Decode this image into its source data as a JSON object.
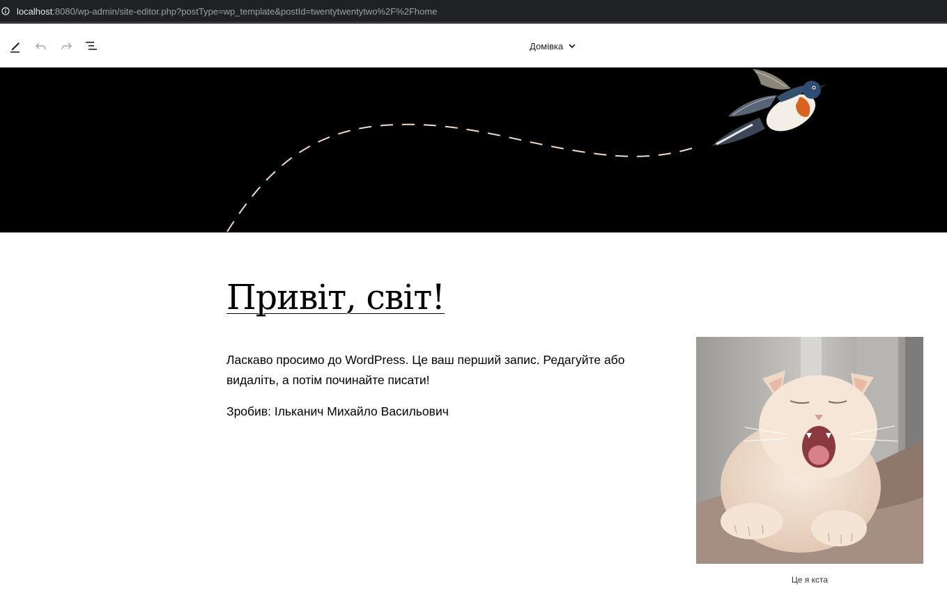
{
  "browser": {
    "url_host": "localhost",
    "url_rest": ":8080/wp-admin/site-editor.php?postType=wp_template&postId=twentytwentytwo%2F%2Fhome"
  },
  "toolbar": {
    "edit_icon": "pencil-icon",
    "undo_icon": "undo-icon",
    "redo_icon": "redo-icon",
    "list_view_icon": "list-view-icon",
    "template_name": "Домівка",
    "template_dropdown_icon": "chevron-down-icon"
  },
  "post": {
    "title": "Привіт, світ!",
    "paragraphs": [
      "Ласкаво просимо до WordPress. Це ваш перший запис. Редагуйте або видаліть, а потім починайте писати!",
      "Зробив: Ільканич Михайло Васильович"
    ],
    "image_caption": "Це я кста"
  },
  "colors": {
    "header_background": "#000000",
    "flight_path": "#f4dcc1",
    "page_background": "#ffffff",
    "text": "#000000"
  }
}
